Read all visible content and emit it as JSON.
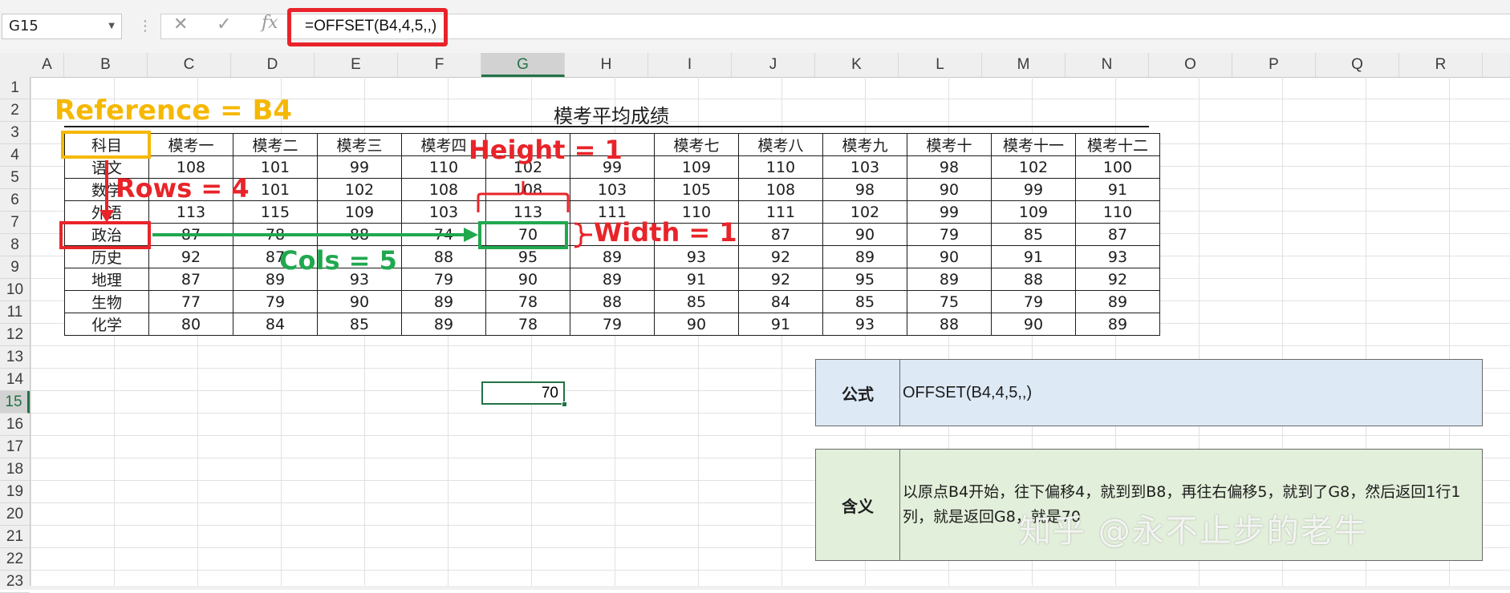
{
  "name_box": "G15",
  "formula_bar": {
    "formula": "=OFFSET(B4,4,5,,)"
  },
  "columns": [
    "A",
    "B",
    "C",
    "D",
    "E",
    "F",
    "G",
    "H",
    "I",
    "J",
    "K",
    "L",
    "M",
    "N",
    "O",
    "P",
    "Q",
    "R"
  ],
  "rows": [
    "1",
    "2",
    "3",
    "4",
    "5",
    "6",
    "7",
    "8",
    "9",
    "10",
    "11",
    "12",
    "13",
    "14",
    "15",
    "16",
    "17",
    "18",
    "19",
    "20",
    "21",
    "22",
    "23"
  ],
  "sheet_title": "模考平均成绩",
  "table": {
    "header": [
      "科目",
      "模考一",
      "模考二",
      "模考三",
      "模考四",
      "",
      "",
      "模考七",
      "模考八",
      "模考九",
      "模考十",
      "模考十一",
      "模考十二"
    ],
    "rows": [
      [
        "语文",
        "108",
        "101",
        "99",
        "110",
        "102",
        "99",
        "109",
        "110",
        "103",
        "98",
        "102",
        "100"
      ],
      [
        "数学",
        "",
        "101",
        "102",
        "108",
        "108",
        "103",
        "105",
        "108",
        "98",
        "90",
        "99",
        "91"
      ],
      [
        "外语",
        "113",
        "115",
        "109",
        "103",
        "113",
        "111",
        "110",
        "111",
        "102",
        "99",
        "109",
        "110"
      ],
      [
        "政治",
        "87",
        "78",
        "88",
        "74",
        "70",
        "",
        "",
        "87",
        "90",
        "79",
        "85",
        "87"
      ],
      [
        "历史",
        "92",
        "87",
        "",
        "88",
        "95",
        "89",
        "93",
        "92",
        "89",
        "90",
        "91",
        "93"
      ],
      [
        "地理",
        "87",
        "89",
        "93",
        "79",
        "90",
        "89",
        "91",
        "92",
        "95",
        "89",
        "88",
        "92"
      ],
      [
        "生物",
        "77",
        "79",
        "90",
        "89",
        "78",
        "88",
        "85",
        "84",
        "85",
        "75",
        "79",
        "89"
      ],
      [
        "化学",
        "80",
        "84",
        "85",
        "89",
        "78",
        "79",
        "90",
        "91",
        "93",
        "88",
        "90",
        "89"
      ]
    ]
  },
  "result_cell_value": "70",
  "annotations": {
    "reference": "Reference = B4",
    "rows": "Rows = 4",
    "cols": "Cols = 5",
    "height": "Height = 1",
    "width": "Width = 1"
  },
  "info": {
    "formula_label": "公式",
    "formula_value": "OFFSET(B4,4,5,,)",
    "meaning_label": "含义",
    "meaning_value": "以原点B4开始，往下偏移4，就到到B8，再往右偏移5，就到了G8，然后返回1行1列，就是返回G8，就是70"
  },
  "watermark": "知乎 @永不止步的老牛",
  "colors": {
    "reference": "#f5b800",
    "red": "#e8242a",
    "green": "#21a84f",
    "excel_green": "#217346",
    "info_blue": "#dde9f5",
    "info_green": "#e2efda"
  }
}
